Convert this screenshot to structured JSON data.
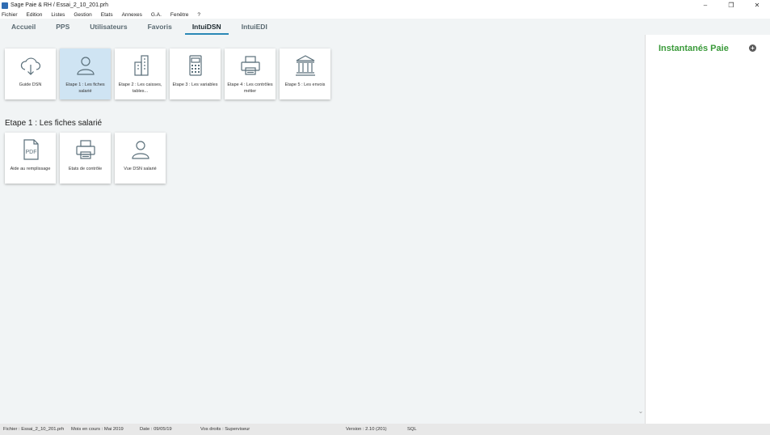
{
  "window": {
    "title": "Sage Paie & RH / Essai_2_10_201.prh",
    "controls": [
      "–",
      "❐",
      "✕"
    ]
  },
  "menu": [
    "Fichier",
    "Edition",
    "Listes",
    "Gestion",
    "Etats",
    "Annexes",
    "G.A.",
    "Fenêtre",
    "?"
  ],
  "tabs": [
    {
      "label": "Accueil",
      "active": false
    },
    {
      "label": "PPS",
      "active": false
    },
    {
      "label": "Utilisateurs",
      "active": false
    },
    {
      "label": "Favoris",
      "active": false
    },
    {
      "label": "IntuiDSN",
      "active": true
    },
    {
      "label": "IntuiEDI",
      "active": false
    }
  ],
  "steps": [
    {
      "label": "Guide DSN",
      "icon": "cloud-download-icon",
      "selected": false
    },
    {
      "label": "Etape 1 : Les fiches salarié",
      "icon": "user-icon",
      "selected": true
    },
    {
      "label": "Etape 2 : Les caisses, tables...",
      "icon": "building-icon",
      "selected": false
    },
    {
      "label": "Etape 3 : Les variables",
      "icon": "calculator-icon",
      "selected": false
    },
    {
      "label": "Etape 4 : Les contrôles métier",
      "icon": "printer-icon",
      "selected": false
    },
    {
      "label": "Etape 5 : Les envois",
      "icon": "bank-icon",
      "selected": false
    }
  ],
  "section": {
    "title": "Etape 1 : Les fiches salarié",
    "items": [
      {
        "label": "Aide au remplissage",
        "icon": "pdf-icon"
      },
      {
        "label": "Etats de contrôle",
        "icon": "printer-icon"
      },
      {
        "label": "Vue DSN salarié",
        "icon": "user-icon"
      }
    ]
  },
  "right_panel": {
    "title": "Instantanés Paie",
    "action": "+"
  },
  "status": {
    "file": "Fichier : Essai_2_10_201.prh",
    "month": "Mois en cours : Mai 2019",
    "date": "Date : 09/05/19",
    "rights": "Vos droits : Superviseur",
    "version": "Version : 2.10 (201)",
    "db": "SQL"
  },
  "colors": {
    "accent": "#2a88b6",
    "panel_title": "#3a9a3a",
    "selected_tile": "#cfe4f3"
  }
}
